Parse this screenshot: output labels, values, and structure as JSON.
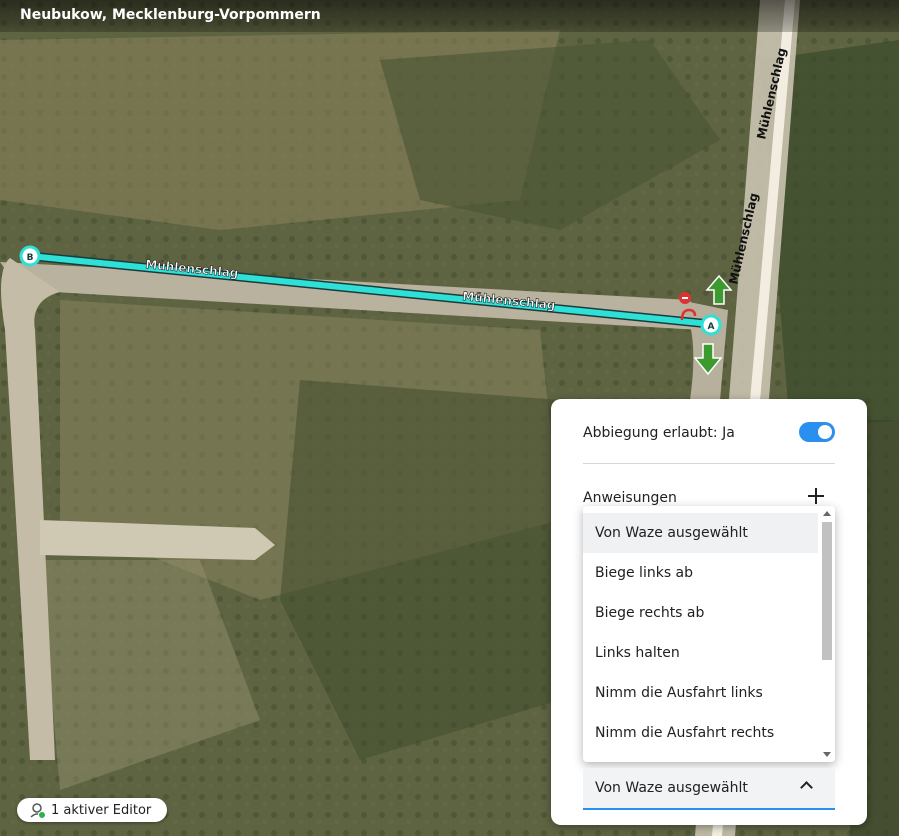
{
  "location": {
    "title": "Neubukow, Mecklenburg-Vorpommern"
  },
  "map": {
    "street_labels": [
      "Mühlenschlag",
      "Mühlenschlag",
      "Mühlenschlag",
      "Mühlenschlag"
    ],
    "node_a": "A",
    "node_b": "B"
  },
  "editors": {
    "label": "1 aktiver Editor"
  },
  "panel": {
    "turn_allowed_label": "Abbiegung erlaubt: Ja",
    "instructions_label": "Anweisungen",
    "options": [
      "Von Waze ausgewählt",
      "Biege links ab",
      "Biege rechts ab",
      "Links halten",
      "Nimm die Ausfahrt links",
      "Nimm die Ausfahrt rechts"
    ],
    "selected": "Von Waze ausgewählt"
  },
  "colors": {
    "segment": "#2ee0d6",
    "toggle": "#2b8ff0",
    "allowed_arrow": "#3c9a2f"
  }
}
